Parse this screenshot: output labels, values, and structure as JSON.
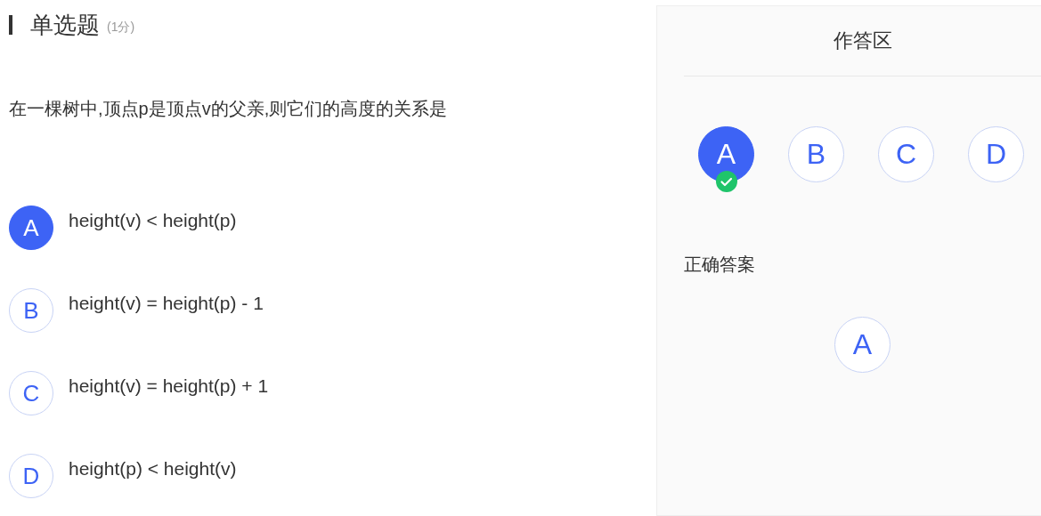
{
  "question": {
    "title": "单选题",
    "score": "(1分)",
    "text": "在一棵树中,顶点p是顶点v的父亲,则它们的高度的关系是",
    "options": [
      {
        "letter": "A",
        "text": "height(v) < height(p)",
        "selected": true
      },
      {
        "letter": "B",
        "text": "height(v) = height(p) - 1",
        "selected": false
      },
      {
        "letter": "C",
        "text": "height(v) = height(p) + 1",
        "selected": false
      },
      {
        "letter": "D",
        "text": "height(p) < height(v)",
        "selected": false
      }
    ]
  },
  "answer_panel": {
    "title": "作答区",
    "choices": [
      {
        "letter": "A",
        "selected": true,
        "correct": true
      },
      {
        "letter": "B",
        "selected": false,
        "correct": false
      },
      {
        "letter": "C",
        "selected": false,
        "correct": false
      },
      {
        "letter": "D",
        "selected": false,
        "correct": false
      }
    ],
    "correct_label": "正确答案",
    "correct_answers": [
      "A"
    ]
  }
}
